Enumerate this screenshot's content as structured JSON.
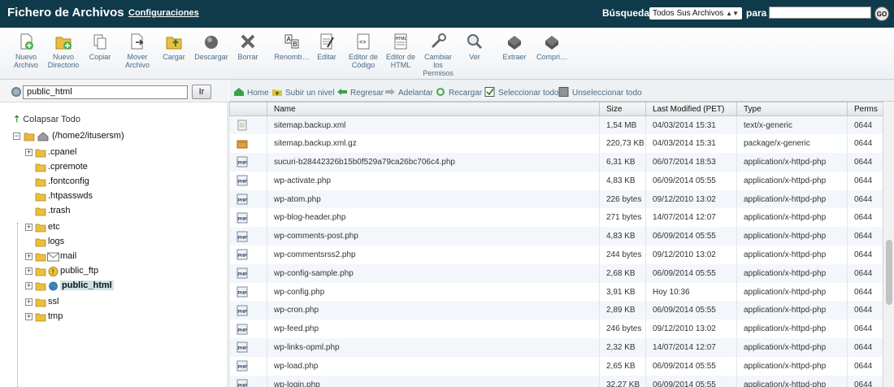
{
  "header": {
    "title": "Fichero de Archivos",
    "settings_link": "Configuraciones",
    "search_label": "Búsqueda",
    "search_scope": "Todos Sus Archivos",
    "for_label": "para",
    "search_value": "",
    "go_label": "GO"
  },
  "toolbar": {
    "items": [
      {
        "label": "Nuevo Archivo",
        "icon": "new-file-icon"
      },
      {
        "label": "Nuevo Directorio",
        "icon": "new-folder-icon"
      },
      {
        "label": "Copiar",
        "icon": "copy-icon"
      },
      {
        "label": "Mover Archivo",
        "icon": "move-icon"
      },
      {
        "label": "Cargar",
        "icon": "upload-icon"
      },
      {
        "label": "Descargar",
        "icon": "download-icon"
      },
      {
        "label": "Borrar",
        "icon": "delete-icon"
      },
      {
        "label": "Renomb…",
        "icon": "rename-icon"
      },
      {
        "label": "Editar",
        "icon": "edit-icon"
      },
      {
        "label": "Editor de Código",
        "icon": "code-editor-icon"
      },
      {
        "label": "Editor de HTML",
        "icon": "html-editor-icon"
      },
      {
        "label": "Cambiar los Permisos",
        "icon": "permissions-icon"
      },
      {
        "label": "Ver",
        "icon": "view-icon"
      },
      {
        "label": "Extraer",
        "icon": "extract-icon"
      },
      {
        "label": "Compri…",
        "icon": "compress-icon"
      }
    ]
  },
  "left": {
    "path_value": "public_html",
    "go_button": "Ir",
    "collapse_all": "Colapsar Todo",
    "tree": {
      "root": "(/home2/itusersm)",
      "children": [
        {
          "label": ".cpanel",
          "expandable": true
        },
        {
          "label": ".cpremote",
          "expandable": false
        },
        {
          "label": ".fontconfig",
          "expandable": false
        },
        {
          "label": ".htpasswds",
          "expandable": false
        },
        {
          "label": ".trash",
          "expandable": false
        },
        {
          "label": "etc",
          "expandable": true
        },
        {
          "label": "logs",
          "expandable": false
        },
        {
          "label": "mail",
          "expandable": true
        },
        {
          "label": "public_ftp",
          "expandable": true
        },
        {
          "label": "public_html",
          "expandable": true,
          "selected": true
        },
        {
          "label": "ssl",
          "expandable": true
        },
        {
          "label": "tmp",
          "expandable": true
        }
      ]
    }
  },
  "nav": {
    "home": "Home",
    "up": "Subir un nivel",
    "back": "Regresar",
    "forward": "Adelantar",
    "reload": "Recargar",
    "select_all": "Seleccionar todo",
    "unselect_all": "Unseleccionar todo"
  },
  "table": {
    "columns": [
      "",
      "Name",
      "Size",
      "Last Modified (PET)",
      "Type",
      "Perms"
    ],
    "rows": [
      {
        "icon": "text",
        "name": "sitemap.backup.xml",
        "size": "1,54 MB",
        "modified": "04/03/2014 15:31",
        "type": "text/x-generic",
        "perms": "0644"
      },
      {
        "icon": "archive",
        "name": "sitemap.backup.xml.gz",
        "size": "220,73 KB",
        "modified": "04/03/2014 15:31",
        "type": "package/x-generic",
        "perms": "0644"
      },
      {
        "icon": "php",
        "name": "sucuri-b28442326b15b0f529a79ca26bc706c4.php",
        "size": "6,31 KB",
        "modified": "06/07/2014 18:53",
        "type": "application/x-httpd-php",
        "perms": "0644"
      },
      {
        "icon": "php",
        "name": "wp-activate.php",
        "size": "4,83 KB",
        "modified": "06/09/2014 05:55",
        "type": "application/x-httpd-php",
        "perms": "0644"
      },
      {
        "icon": "php",
        "name": "wp-atom.php",
        "size": "226 bytes",
        "modified": "09/12/2010 13:02",
        "type": "application/x-httpd-php",
        "perms": "0644"
      },
      {
        "icon": "php",
        "name": "wp-blog-header.php",
        "size": "271 bytes",
        "modified": "14/07/2014 12:07",
        "type": "application/x-httpd-php",
        "perms": "0644"
      },
      {
        "icon": "php",
        "name": "wp-comments-post.php",
        "size": "4,83 KB",
        "modified": "06/09/2014 05:55",
        "type": "application/x-httpd-php",
        "perms": "0644"
      },
      {
        "icon": "php",
        "name": "wp-commentsrss2.php",
        "size": "244 bytes",
        "modified": "09/12/2010 13:02",
        "type": "application/x-httpd-php",
        "perms": "0644"
      },
      {
        "icon": "php",
        "name": "wp-config-sample.php",
        "size": "2,68 KB",
        "modified": "06/09/2014 05:55",
        "type": "application/x-httpd-php",
        "perms": "0644"
      },
      {
        "icon": "php",
        "name": "wp-config.php",
        "size": "3,91 KB",
        "modified": "Hoy 10:36",
        "type": "application/x-httpd-php",
        "perms": "0644"
      },
      {
        "icon": "php",
        "name": "wp-cron.php",
        "size": "2,89 KB",
        "modified": "06/09/2014 05:55",
        "type": "application/x-httpd-php",
        "perms": "0644"
      },
      {
        "icon": "php",
        "name": "wp-feed.php",
        "size": "246 bytes",
        "modified": "09/12/2010 13:02",
        "type": "application/x-httpd-php",
        "perms": "0644"
      },
      {
        "icon": "php",
        "name": "wp-links-opml.php",
        "size": "2,32 KB",
        "modified": "14/07/2014 12:07",
        "type": "application/x-httpd-php",
        "perms": "0644"
      },
      {
        "icon": "php",
        "name": "wp-load.php",
        "size": "2,65 KB",
        "modified": "06/09/2014 05:55",
        "type": "application/x-httpd-php",
        "perms": "0644"
      },
      {
        "icon": "php",
        "name": "wp-login.php",
        "size": "32,27 KB",
        "modified": "06/09/2014 05:55",
        "type": "application/x-httpd-php",
        "perms": "0644"
      }
    ]
  }
}
